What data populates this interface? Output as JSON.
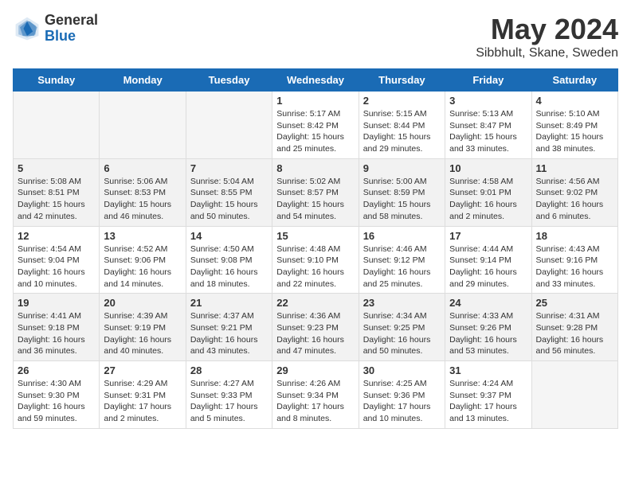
{
  "header": {
    "logo_general": "General",
    "logo_blue": "Blue",
    "month_title": "May 2024",
    "location": "Sibbhult, Skane, Sweden"
  },
  "days_of_week": [
    "Sunday",
    "Monday",
    "Tuesday",
    "Wednesday",
    "Thursday",
    "Friday",
    "Saturday"
  ],
  "weeks": [
    {
      "days": [
        {
          "num": "",
          "info": ""
        },
        {
          "num": "",
          "info": ""
        },
        {
          "num": "",
          "info": ""
        },
        {
          "num": "1",
          "info": "Sunrise: 5:17 AM\nSunset: 8:42 PM\nDaylight: 15 hours\nand 25 minutes."
        },
        {
          "num": "2",
          "info": "Sunrise: 5:15 AM\nSunset: 8:44 PM\nDaylight: 15 hours\nand 29 minutes."
        },
        {
          "num": "3",
          "info": "Sunrise: 5:13 AM\nSunset: 8:47 PM\nDaylight: 15 hours\nand 33 minutes."
        },
        {
          "num": "4",
          "info": "Sunrise: 5:10 AM\nSunset: 8:49 PM\nDaylight: 15 hours\nand 38 minutes."
        }
      ]
    },
    {
      "days": [
        {
          "num": "5",
          "info": "Sunrise: 5:08 AM\nSunset: 8:51 PM\nDaylight: 15 hours\nand 42 minutes."
        },
        {
          "num": "6",
          "info": "Sunrise: 5:06 AM\nSunset: 8:53 PM\nDaylight: 15 hours\nand 46 minutes."
        },
        {
          "num": "7",
          "info": "Sunrise: 5:04 AM\nSunset: 8:55 PM\nDaylight: 15 hours\nand 50 minutes."
        },
        {
          "num": "8",
          "info": "Sunrise: 5:02 AM\nSunset: 8:57 PM\nDaylight: 15 hours\nand 54 minutes."
        },
        {
          "num": "9",
          "info": "Sunrise: 5:00 AM\nSunset: 8:59 PM\nDaylight: 15 hours\nand 58 minutes."
        },
        {
          "num": "10",
          "info": "Sunrise: 4:58 AM\nSunset: 9:01 PM\nDaylight: 16 hours\nand 2 minutes."
        },
        {
          "num": "11",
          "info": "Sunrise: 4:56 AM\nSunset: 9:02 PM\nDaylight: 16 hours\nand 6 minutes."
        }
      ]
    },
    {
      "days": [
        {
          "num": "12",
          "info": "Sunrise: 4:54 AM\nSunset: 9:04 PM\nDaylight: 16 hours\nand 10 minutes."
        },
        {
          "num": "13",
          "info": "Sunrise: 4:52 AM\nSunset: 9:06 PM\nDaylight: 16 hours\nand 14 minutes."
        },
        {
          "num": "14",
          "info": "Sunrise: 4:50 AM\nSunset: 9:08 PM\nDaylight: 16 hours\nand 18 minutes."
        },
        {
          "num": "15",
          "info": "Sunrise: 4:48 AM\nSunset: 9:10 PM\nDaylight: 16 hours\nand 22 minutes."
        },
        {
          "num": "16",
          "info": "Sunrise: 4:46 AM\nSunset: 9:12 PM\nDaylight: 16 hours\nand 25 minutes."
        },
        {
          "num": "17",
          "info": "Sunrise: 4:44 AM\nSunset: 9:14 PM\nDaylight: 16 hours\nand 29 minutes."
        },
        {
          "num": "18",
          "info": "Sunrise: 4:43 AM\nSunset: 9:16 PM\nDaylight: 16 hours\nand 33 minutes."
        }
      ]
    },
    {
      "days": [
        {
          "num": "19",
          "info": "Sunrise: 4:41 AM\nSunset: 9:18 PM\nDaylight: 16 hours\nand 36 minutes."
        },
        {
          "num": "20",
          "info": "Sunrise: 4:39 AM\nSunset: 9:19 PM\nDaylight: 16 hours\nand 40 minutes."
        },
        {
          "num": "21",
          "info": "Sunrise: 4:37 AM\nSunset: 9:21 PM\nDaylight: 16 hours\nand 43 minutes."
        },
        {
          "num": "22",
          "info": "Sunrise: 4:36 AM\nSunset: 9:23 PM\nDaylight: 16 hours\nand 47 minutes."
        },
        {
          "num": "23",
          "info": "Sunrise: 4:34 AM\nSunset: 9:25 PM\nDaylight: 16 hours\nand 50 minutes."
        },
        {
          "num": "24",
          "info": "Sunrise: 4:33 AM\nSunset: 9:26 PM\nDaylight: 16 hours\nand 53 minutes."
        },
        {
          "num": "25",
          "info": "Sunrise: 4:31 AM\nSunset: 9:28 PM\nDaylight: 16 hours\nand 56 minutes."
        }
      ]
    },
    {
      "days": [
        {
          "num": "26",
          "info": "Sunrise: 4:30 AM\nSunset: 9:30 PM\nDaylight: 16 hours\nand 59 minutes."
        },
        {
          "num": "27",
          "info": "Sunrise: 4:29 AM\nSunset: 9:31 PM\nDaylight: 17 hours\nand 2 minutes."
        },
        {
          "num": "28",
          "info": "Sunrise: 4:27 AM\nSunset: 9:33 PM\nDaylight: 17 hours\nand 5 minutes."
        },
        {
          "num": "29",
          "info": "Sunrise: 4:26 AM\nSunset: 9:34 PM\nDaylight: 17 hours\nand 8 minutes."
        },
        {
          "num": "30",
          "info": "Sunrise: 4:25 AM\nSunset: 9:36 PM\nDaylight: 17 hours\nand 10 minutes."
        },
        {
          "num": "31",
          "info": "Sunrise: 4:24 AM\nSunset: 9:37 PM\nDaylight: 17 hours\nand 13 minutes."
        },
        {
          "num": "",
          "info": ""
        }
      ]
    }
  ]
}
